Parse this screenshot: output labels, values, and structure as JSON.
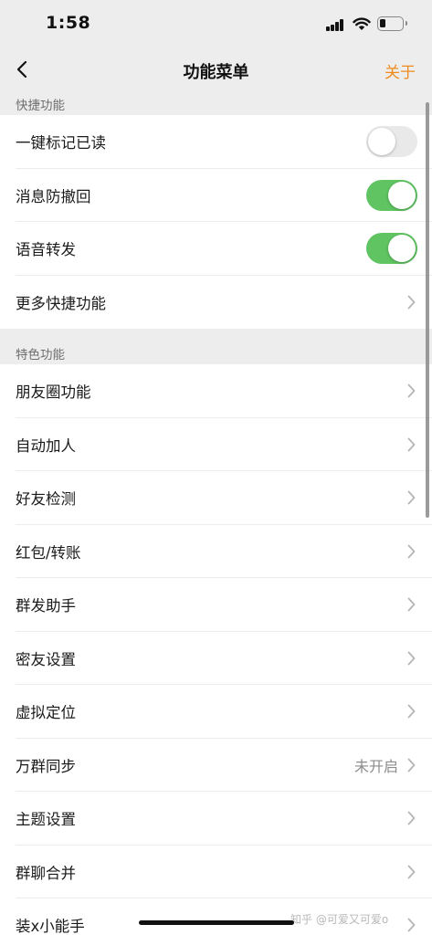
{
  "status_bar": {
    "time": "1:58"
  },
  "nav": {
    "title": "功能菜单",
    "about": "关于"
  },
  "sections": {
    "quick": {
      "header": "快捷功能"
    },
    "special": {
      "header": "特色功能"
    }
  },
  "quick_items": [
    {
      "label": "一键标记已读",
      "toggle": false
    },
    {
      "label": "消息防撤回",
      "toggle": true
    },
    {
      "label": "语音转发",
      "toggle": true
    },
    {
      "label": "更多快捷功能"
    }
  ],
  "special_items": [
    {
      "label": "朋友圈功能"
    },
    {
      "label": "自动加人"
    },
    {
      "label": "好友检测"
    },
    {
      "label": "红包/转账"
    },
    {
      "label": "群发助手"
    },
    {
      "label": "密友设置"
    },
    {
      "label": "虚拟定位"
    },
    {
      "label": "万群同步",
      "value": "未开启"
    },
    {
      "label": "主题设置"
    },
    {
      "label": "群聊合并"
    },
    {
      "label": "装x小能手"
    }
  ],
  "watermark": "知乎 @可爱又可爱o",
  "colors": {
    "accent": "#f08c1d",
    "toggle_on": "#5fc461",
    "toggle_off": "#e9e9ea",
    "background": "#ededed"
  }
}
